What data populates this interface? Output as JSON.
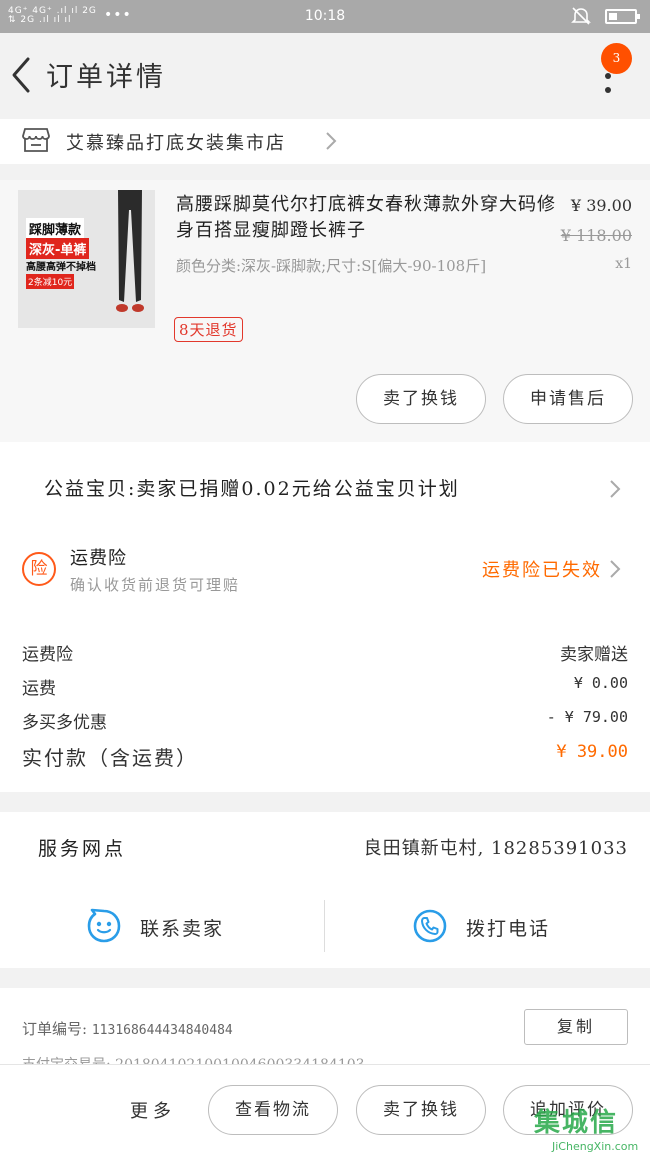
{
  "status_bar": {
    "signal_top": "4G⁺ 4G⁺ .ıl ıl 2G",
    "signal_bottom": "⇅   2G  .ıl ıl ıl",
    "dots": "•••",
    "time": "10:18"
  },
  "header": {
    "title": "订单详情",
    "badge_count": "3"
  },
  "shop": {
    "name": "艾慕臻品打底女装集市店"
  },
  "product": {
    "thumb_line1": "踩脚薄款",
    "thumb_line2": "深灰-单裤",
    "thumb_line3": "高腰高弹不掉档",
    "thumb_line4": "2条减10元",
    "title": "高腰踩脚莫代尔打底裤女春秋薄款外穿大码修身百搭显瘦脚蹬长裤子",
    "sku": "颜色分类:深灰-踩脚款;尺寸:S[偏大-90-108斤]",
    "tag": "8天退货",
    "price": "¥ 39.00",
    "original_price": "¥ 118.00",
    "quantity": "x1",
    "btn_sell_back": "卖了换钱",
    "btn_after_sale": "申请售后"
  },
  "charity": {
    "text": "公益宝贝:卖家已捐赠0.02元给公益宝贝计划"
  },
  "insurance": {
    "icon_char": "险",
    "title": "运费险",
    "subtitle": "确认收货前退货可理赔",
    "status": "运费险已失效"
  },
  "fees": {
    "rows": [
      {
        "label": "运费险",
        "value": "卖家赠送"
      },
      {
        "label": "运费",
        "value": "¥ 0.00"
      },
      {
        "label": "多买多优惠",
        "value": "- ¥ 79.00"
      }
    ],
    "total_label": "实付款（含运费）",
    "total_value": "¥ 39.00"
  },
  "service": {
    "label": "服务网点",
    "value": "良田镇新屯村, 18285391033",
    "contact_seller": "联系卖家",
    "call_phone": "拨打电话"
  },
  "order": {
    "number_label": "订单编号:",
    "number_value": "113168644434840484",
    "copy": "复制",
    "payment_cut": "支付宝交易号: 2018041021001004600334184103"
  },
  "bottom": {
    "more": "更多",
    "logistics": "查看物流",
    "sell_back": "卖了换钱",
    "review": "追加评价"
  },
  "watermark": {
    "big": "集城信",
    "small": "JiChengXin.com"
  },
  "colors": {
    "accent_orange": "#ff6a00",
    "badge": "#ff5000",
    "tag_red": "#e2382c",
    "service_blue": "#2a9de8"
  }
}
